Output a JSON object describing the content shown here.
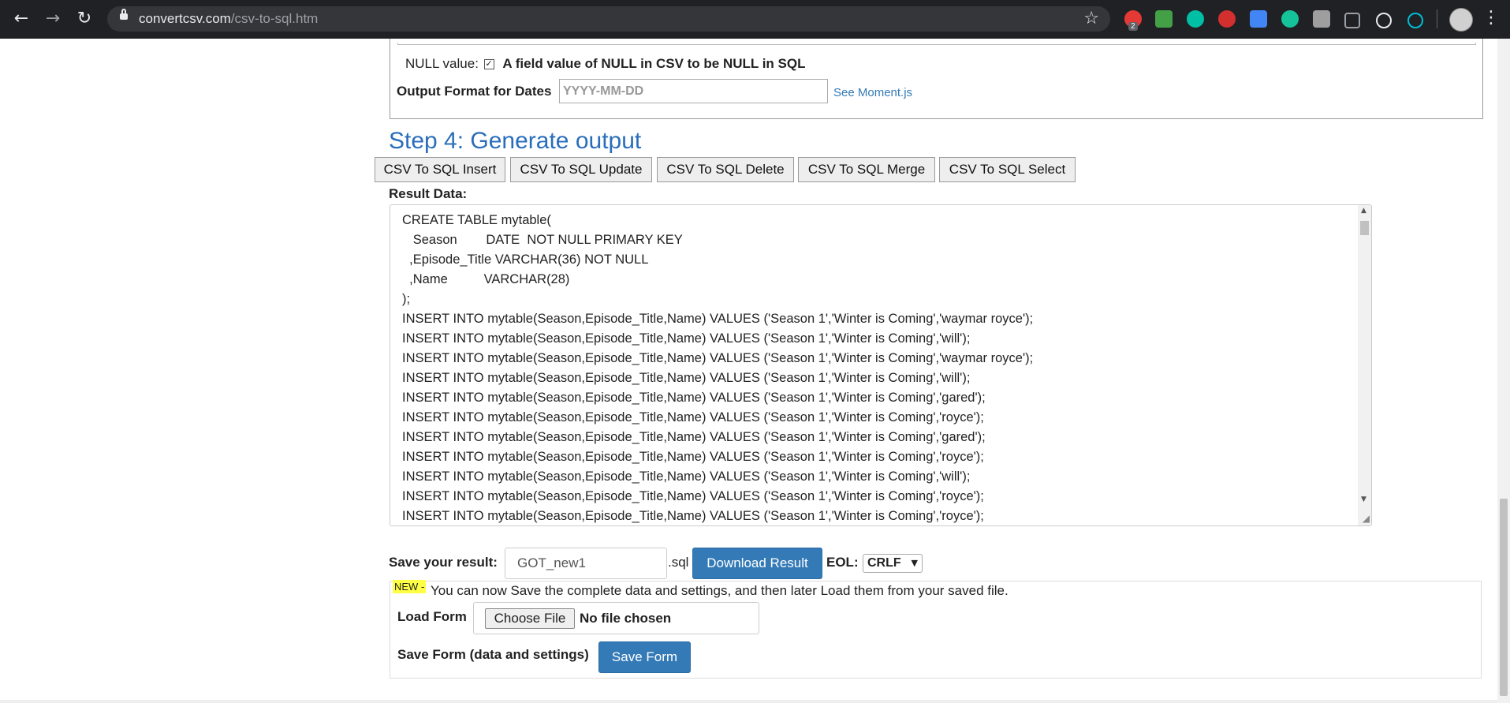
{
  "browser": {
    "url_domain": "convertcsv.com",
    "url_path": "/csv-to-sql.htm",
    "extension_badge": "2"
  },
  "options": {
    "null_label": "NULL value:",
    "null_checked": true,
    "null_description": "A field value of NULL in CSV to be NULL in SQL",
    "dates_label": "Output Format for Dates",
    "dates_placeholder": "YYYY-MM-DD",
    "moment_link": "See Moment.js"
  },
  "step4": {
    "heading": "Step 4: Generate output",
    "buttons": [
      "CSV To SQL Insert",
      "CSV To SQL Update",
      "CSV To SQL Delete",
      "CSV To SQL Merge",
      "CSV To SQL Select"
    ],
    "result_label": "Result Data:",
    "result_lines": [
      "CREATE TABLE mytable(",
      "   Season        DATE  NOT NULL PRIMARY KEY",
      "  ,Episode_Title VARCHAR(36) NOT NULL",
      "  ,Name          VARCHAR(28)",
      ");",
      "INSERT INTO mytable(Season,Episode_Title,Name) VALUES ('Season 1','Winter is Coming','waymar royce');",
      "INSERT INTO mytable(Season,Episode_Title,Name) VALUES ('Season 1','Winter is Coming','will');",
      "INSERT INTO mytable(Season,Episode_Title,Name) VALUES ('Season 1','Winter is Coming','waymar royce');",
      "INSERT INTO mytable(Season,Episode_Title,Name) VALUES ('Season 1','Winter is Coming','will');",
      "INSERT INTO mytable(Season,Episode_Title,Name) VALUES ('Season 1','Winter is Coming','gared');",
      "INSERT INTO mytable(Season,Episode_Title,Name) VALUES ('Season 1','Winter is Coming','royce');",
      "INSERT INTO mytable(Season,Episode_Title,Name) VALUES ('Season 1','Winter is Coming','gared');",
      "INSERT INTO mytable(Season,Episode_Title,Name) VALUES ('Season 1','Winter is Coming','royce');",
      "INSERT INTO mytable(Season,Episode_Title,Name) VALUES ('Season 1','Winter is Coming','will');",
      "INSERT INTO mytable(Season,Episode_Title,Name) VALUES ('Season 1','Winter is Coming','royce');",
      "INSERT INTO mytable(Season,Episode_Title,Name) VALUES ('Season 1','Winter is Coming','royce');"
    ]
  },
  "save": {
    "label": "Save your result:",
    "filename": "GOT_new1",
    "extension": ".sql",
    "download_button": "Download Result",
    "eol_label": "EOL:",
    "eol_value": "CRLF"
  },
  "form": {
    "new_tag": "NEW -",
    "new_text": "You can now Save the complete data and settings, and then later Load them from your saved file.",
    "load_label": "Load Form",
    "choose_file": "Choose File",
    "no_file": "No file chosen",
    "save_form_label": "Save Form (data and settings)",
    "save_form_button": "Save Form"
  }
}
